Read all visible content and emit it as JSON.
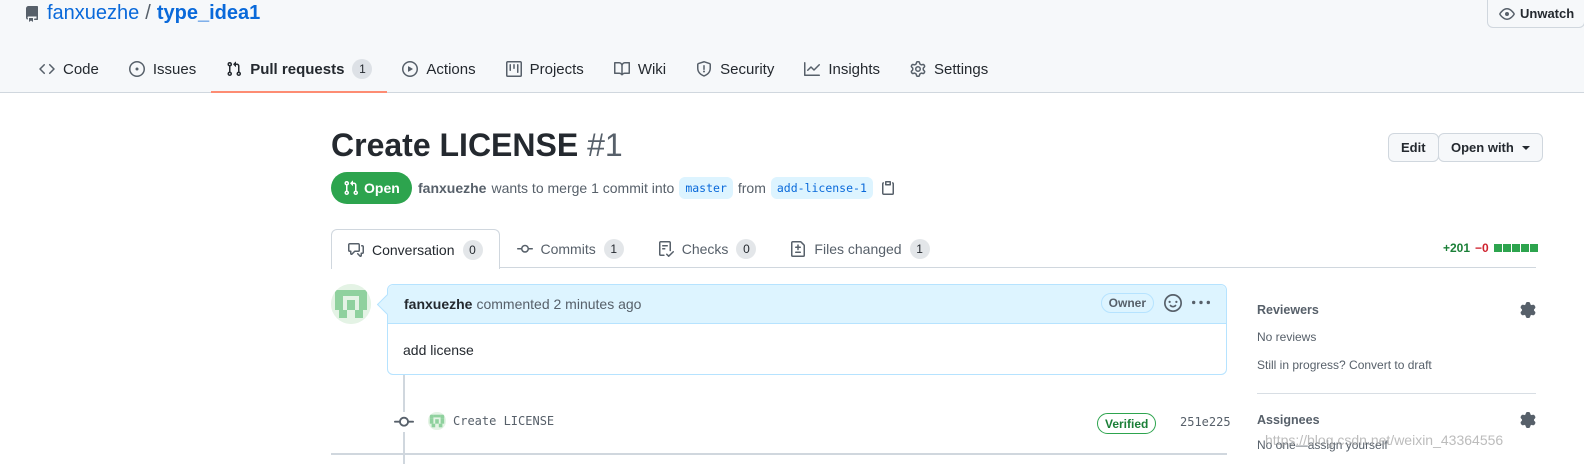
{
  "repo": {
    "owner": "fanxuezhe",
    "separator": "/",
    "name": "type_idea1",
    "unwatch_label": "Unwatch"
  },
  "repo_tabs": [
    {
      "label": "Code",
      "icon": "code-icon"
    },
    {
      "label": "Issues",
      "icon": "issue-icon"
    },
    {
      "label": "Pull requests",
      "icon": "pull-request-icon",
      "count": "1",
      "selected": true
    },
    {
      "label": "Actions",
      "icon": "play-icon"
    },
    {
      "label": "Projects",
      "icon": "project-icon"
    },
    {
      "label": "Wiki",
      "icon": "book-icon"
    },
    {
      "label": "Security",
      "icon": "shield-icon"
    },
    {
      "label": "Insights",
      "icon": "graph-icon"
    },
    {
      "label": "Settings",
      "icon": "gear-icon"
    }
  ],
  "pr": {
    "title": "Create LICENSE",
    "number": "#1",
    "edit_label": "Edit",
    "open_with_label": "Open with",
    "state": "Open",
    "author": "fanxuezhe",
    "merge_text": "wants to merge 1 commit into",
    "base_branch": "master",
    "from_text": "from",
    "head_branch": "add-license-1"
  },
  "pr_tabs": [
    {
      "label": "Conversation",
      "count": "0",
      "icon": "comment-discussion-icon",
      "selected": true
    },
    {
      "label": "Commits",
      "count": "1",
      "icon": "git-commit-icon"
    },
    {
      "label": "Checks",
      "count": "0",
      "icon": "checklist-icon"
    },
    {
      "label": "Files changed",
      "count": "1",
      "icon": "file-diff-icon"
    }
  ],
  "diffstat": {
    "additions": "+201",
    "deletions": "−0",
    "blocks": 5,
    "color": "#2da44e"
  },
  "comment": {
    "author": "fanxuezhe",
    "meta": "commented 2 minutes ago",
    "role": "Owner",
    "body": "add license"
  },
  "commit": {
    "message": "Create LICENSE",
    "verified": "Verified",
    "sha": "251e225"
  },
  "sidebar": {
    "reviewers": {
      "heading": "Reviewers",
      "text": "No reviews",
      "link": "Still in progress? Convert to draft"
    },
    "assignees": {
      "heading": "Assignees",
      "text": "No one—assign yourself"
    }
  },
  "watermark": "https://blog.csdn.net/weixin_43364556",
  "colors": {
    "accent": "#0969da",
    "open_green": "#2da44e",
    "selected_tab_underline": "#fd8c73"
  }
}
